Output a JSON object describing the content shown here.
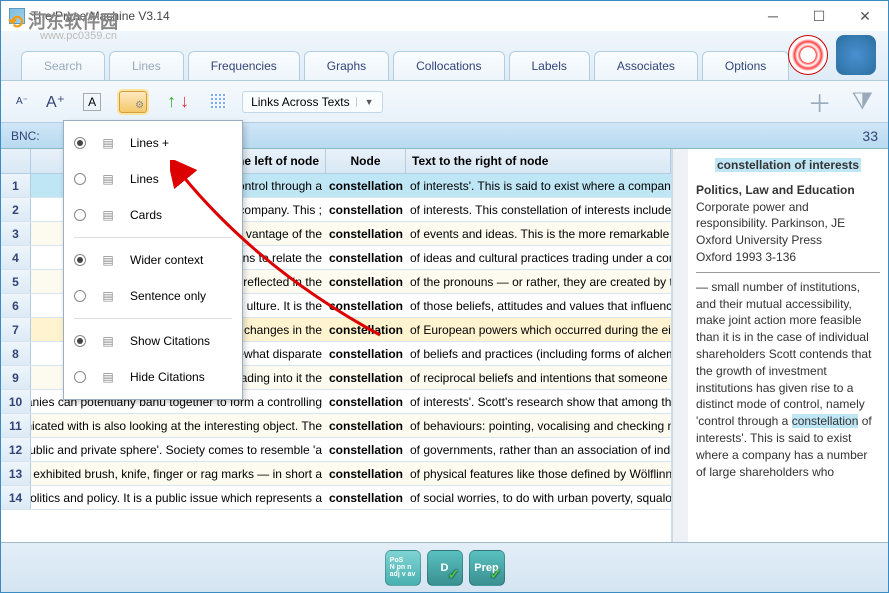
{
  "window": {
    "title": "The Prime Machine V3.14"
  },
  "watermark": {
    "cn": "河东软件园",
    "url": "www.pc0359.cn"
  },
  "tabs": [
    "Search",
    "Lines",
    "Frequencies",
    "Graphs",
    "Collocations",
    "Labels",
    "Associates",
    "Options"
  ],
  "toolbar": {
    "links_label": "Links Across Texts"
  },
  "corpus_bar": {
    "label": "BNC:",
    "count": "33"
  },
  "view_menu": {
    "items": [
      {
        "label": "Lines +",
        "selected": true,
        "icon": "lines-plus"
      },
      {
        "label": "Lines",
        "selected": false,
        "icon": "lines"
      },
      {
        "label": "Cards",
        "selected": false,
        "icon": "cards"
      },
      {
        "label": "Wider context",
        "selected": true,
        "icon": "wider"
      },
      {
        "label": "Sentence only",
        "selected": false,
        "icon": "sentence"
      },
      {
        "label": "Show Citations",
        "selected": true,
        "icon": "cite-show"
      },
      {
        "label": "Hide Citations",
        "selected": false,
        "icon": "cite-hide"
      }
    ]
  },
  "headers": {
    "left": "he left of node",
    "node": "Node",
    "right": "Text to the right of node"
  },
  "rows": [
    {
      "n": "1",
      "left": "se to …                    control through a",
      "node": "constellation",
      "right": "of interests'. This is said to exist where a company has",
      "sel": true
    },
    {
      "n": "2",
      "left": "; and                                                    company. This",
      "node": "constellation",
      "right": "of interests. This constellation of interests includes ent"
    },
    {
      "n": "3",
      "left": "anies                                             vantage of the",
      "node": "constellation",
      "right": "of events and ideas. This is the more remarkable in view"
    },
    {
      "n": "4",
      "left": "olutic                                        ns to relate the",
      "node": "constellation",
      "right": "of ideas and cultural practices trading under a concepti"
    },
    {
      "n": "5",
      "left": "ma                                            reflected in the",
      "node": "constellation",
      "right": "of the pronouns — or rather, they are created by the p"
    },
    {
      "n": "6",
      "left": "Cu                                                 ulture. It is the",
      "node": "constellation",
      "right": "of those beliefs, attitudes and values that influence sul"
    },
    {
      "n": "7",
      "left": "osc                                             e changes in the",
      "node": "constellation",
      "right": "of European powers which occurred during the eighteer",
      "hov": true
    },
    {
      "n": "8",
      "left": "pra                                            ewhat disparate",
      "node": "constellation",
      "right": "of beliefs and practices (including forms of alchemy and"
    },
    {
      "n": "9",
      "left": "no                                             ading into it the",
      "node": "constellation",
      "right": "of reciprocal beliefs and intentions that someone like Le"
    },
    {
      "n": "10",
      "left": "anies can potentiany banu togetner to form a controlling `",
      "node": "constellation",
      "right": "of interests'. Scott's research show that among the top"
    },
    {
      "n": "11",
      "left": "unicated with is also looking at the interesting object. The",
      "node": "constellation",
      "right": "of behaviours: pointing, vocalising and checking may se"
    },
    {
      "n": "12",
      "left": "e public and private sphere'. Society comes to resemble 'a",
      "node": "constellation",
      "right": "of governments, rather than an association of individua"
    },
    {
      "n": "13",
      "left": "t; exhibited brush, knife, finger or rag marks — in short a",
      "node": "constellation",
      "right": "of physical features like those defined by Wölflinn wher"
    },
    {
      "n": "14",
      "left": "r politics and policy. It is a public issue which represents a",
      "node": "constellation",
      "right": "of social worries, to do with urban poverty, squalor, ill-"
    }
  ],
  "side": {
    "title_phrase": "constellation of interests",
    "meta": {
      "heading": "Politics, Law and Education",
      "l1": "Corporate power and responsibility. Parkinson, JE",
      "l2": "Oxford University Press",
      "l3": "Oxford 1993 3-136"
    },
    "body_pre": "— small number of institutions, and their mutual accessibility, make joint action more feasible than it is in the case of individual shareholders Scott contends that the growth of investment institutions has given rise to a distinct mode of control, namely 'control through a ",
    "body_hl": "constellation",
    "body_post": " of interests'. This is said to exist where a company has a number of large shareholders who"
  },
  "status": {
    "b1": "PoS\\nN pn n\\nadj v av",
    "b2": "D",
    "b3": "Prep"
  }
}
